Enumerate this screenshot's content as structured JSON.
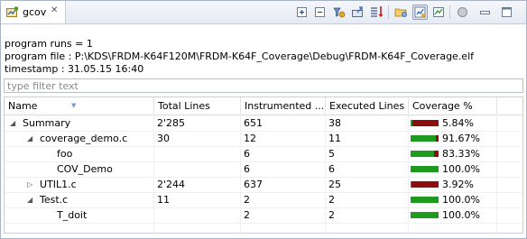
{
  "view": {
    "tab_title": "gcov",
    "tab_icon": "gcov-view-icon"
  },
  "toolbar": [
    {
      "icon": "expand-all-icon"
    },
    {
      "icon": "collapse-all-icon"
    },
    {
      "icon": "filter-icon"
    },
    {
      "icon": "export-icon"
    },
    {
      "icon": "sort-icon"
    },
    {
      "icon": "open-folder-icon"
    },
    {
      "icon": "toggle-view-icon",
      "active": true
    },
    {
      "icon": "chart-icon"
    },
    {
      "icon": "pin-icon"
    },
    {
      "icon": "minimize-icon"
    },
    {
      "icon": "maximize-icon"
    }
  ],
  "info": {
    "runs": "program runs = 1",
    "file": "program file : P:\\KDS\\FRDM-K64F120M\\FRDM-K64F_Coverage\\Debug\\FRDM-K64F_Coverage.elf",
    "timestamp": "timestamp : 31.05.15 16:40"
  },
  "filter": {
    "placeholder": "type filter text"
  },
  "table": {
    "columns": [
      "Name",
      "Total Lines",
      "Instrumented ...",
      "Executed Lines",
      "Coverage %"
    ],
    "rows": [
      {
        "name": "Summary",
        "level": 0,
        "twisty": "expanded",
        "total": "2'285",
        "instrumented": "651",
        "executed": "38",
        "coverage": "5.84%",
        "coverage_value": 5.84
      },
      {
        "name": "coverage_demo.c",
        "level": 1,
        "twisty": "expanded",
        "total": "30",
        "instrumented": "12",
        "executed": "11",
        "coverage": "91.67%",
        "coverage_value": 91.67
      },
      {
        "name": "foo",
        "level": 2,
        "twisty": "none",
        "total": "",
        "instrumented": "6",
        "executed": "5",
        "coverage": "83.33%",
        "coverage_value": 83.33
      },
      {
        "name": "COV_Demo",
        "level": 2,
        "twisty": "none",
        "total": "",
        "instrumented": "6",
        "executed": "6",
        "coverage": "100.0%",
        "coverage_value": 100
      },
      {
        "name": "UTIL1.c",
        "level": 1,
        "twisty": "collapsed",
        "total": "2'244",
        "instrumented": "637",
        "executed": "25",
        "coverage": "3.92%",
        "coverage_value": 3.92
      },
      {
        "name": "Test.c",
        "level": 1,
        "twisty": "expanded",
        "total": "11",
        "instrumented": "2",
        "executed": "2",
        "coverage": "100.0%",
        "coverage_value": 100
      },
      {
        "name": "T_doit",
        "level": 2,
        "twisty": "none",
        "total": "",
        "instrumented": "2",
        "executed": "2",
        "coverage": "100.0%",
        "coverage_value": 100
      }
    ]
  },
  "colors": {
    "covered": "#1e9a1e",
    "uncovered": "#8b0f0f",
    "accent": "#7fa3d4"
  }
}
